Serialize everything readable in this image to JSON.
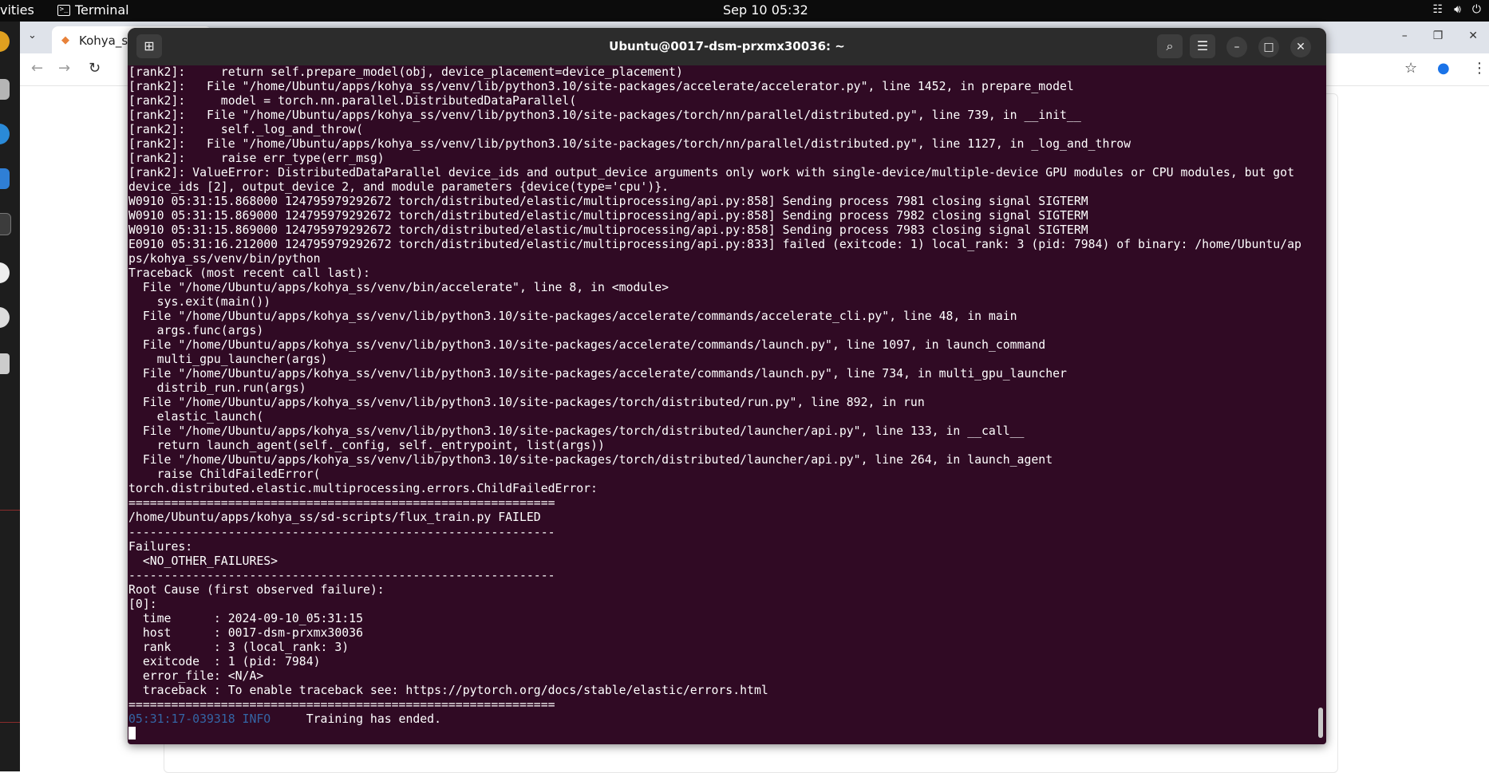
{
  "topbar": {
    "activities": "vities",
    "app_name": "Terminal",
    "clock": "Sep 10  05:32"
  },
  "browser": {
    "tab_title": "Kohya_ss"
  },
  "terminal": {
    "title": "Ubuntu@0017-dsm-prxmx30036: ~",
    "lines": [
      "[rank2]:     return self.prepare_model(obj, device_placement=device_placement)",
      "[rank2]:   File \"/home/Ubuntu/apps/kohya_ss/venv/lib/python3.10/site-packages/accelerate/accelerator.py\", line 1452, in prepare_model",
      "[rank2]:     model = torch.nn.parallel.DistributedDataParallel(",
      "[rank2]:   File \"/home/Ubuntu/apps/kohya_ss/venv/lib/python3.10/site-packages/torch/nn/parallel/distributed.py\", line 739, in __init__",
      "[rank2]:     self._log_and_throw(",
      "[rank2]:   File \"/home/Ubuntu/apps/kohya_ss/venv/lib/python3.10/site-packages/torch/nn/parallel/distributed.py\", line 1127, in _log_and_throw",
      "[rank2]:     raise err_type(err_msg)",
      "[rank2]: ValueError: DistributedDataParallel device_ids and output_device arguments only work with single-device/multiple-device GPU modules or CPU modules, but got",
      "device_ids [2], output_device 2, and module parameters {device(type='cpu')}.",
      "W0910 05:31:15.868000 124795979292672 torch/distributed/elastic/multiprocessing/api.py:858] Sending process 7981 closing signal SIGTERM",
      "W0910 05:31:15.869000 124795979292672 torch/distributed/elastic/multiprocessing/api.py:858] Sending process 7982 closing signal SIGTERM",
      "W0910 05:31:15.869000 124795979292672 torch/distributed/elastic/multiprocessing/api.py:858] Sending process 7983 closing signal SIGTERM",
      "E0910 05:31:16.212000 124795979292672 torch/distributed/elastic/multiprocessing/api.py:833] failed (exitcode: 1) local_rank: 3 (pid: 7984) of binary: /home/Ubuntu/ap",
      "ps/kohya_ss/venv/bin/python",
      "Traceback (most recent call last):",
      "  File \"/home/Ubuntu/apps/kohya_ss/venv/bin/accelerate\", line 8, in <module>",
      "    sys.exit(main())",
      "  File \"/home/Ubuntu/apps/kohya_ss/venv/lib/python3.10/site-packages/accelerate/commands/accelerate_cli.py\", line 48, in main",
      "    args.func(args)",
      "  File \"/home/Ubuntu/apps/kohya_ss/venv/lib/python3.10/site-packages/accelerate/commands/launch.py\", line 1097, in launch_command",
      "    multi_gpu_launcher(args)",
      "  File \"/home/Ubuntu/apps/kohya_ss/venv/lib/python3.10/site-packages/accelerate/commands/launch.py\", line 734, in multi_gpu_launcher",
      "    distrib_run.run(args)",
      "  File \"/home/Ubuntu/apps/kohya_ss/venv/lib/python3.10/site-packages/torch/distributed/run.py\", line 892, in run",
      "    elastic_launch(",
      "  File \"/home/Ubuntu/apps/kohya_ss/venv/lib/python3.10/site-packages/torch/distributed/launcher/api.py\", line 133, in __call__",
      "    return launch_agent(self._config, self._entrypoint, list(args))",
      "  File \"/home/Ubuntu/apps/kohya_ss/venv/lib/python3.10/site-packages/torch/distributed/launcher/api.py\", line 264, in launch_agent",
      "    raise ChildFailedError(",
      "torch.distributed.elastic.multiprocessing.errors.ChildFailedError:",
      "============================================================",
      "/home/Ubuntu/apps/kohya_ss/sd-scripts/flux_train.py FAILED",
      "------------------------------------------------------------",
      "Failures:",
      "  <NO_OTHER_FAILURES>",
      "------------------------------------------------------------",
      "Root Cause (first observed failure):",
      "[0]:",
      "  time      : 2024-09-10_05:31:15",
      "  host      : 0017-dsm-prxmx30036",
      "  rank      : 3 (local_rank: 3)",
      "  exitcode  : 1 (pid: 7984)",
      "  error_file: <N/A>",
      "  traceback : To enable traceback see: https://pytorch.org/docs/stable/elastic/errors.html",
      "============================================================"
    ],
    "info_line": {
      "timestamp": "05:31:17-039318",
      "level": "INFO",
      "message": "     Training has ended."
    }
  },
  "colors": {
    "terminal_bg": "#300a24",
    "header_bg": "#2c2c2c",
    "info_blue": "#3465a4"
  }
}
